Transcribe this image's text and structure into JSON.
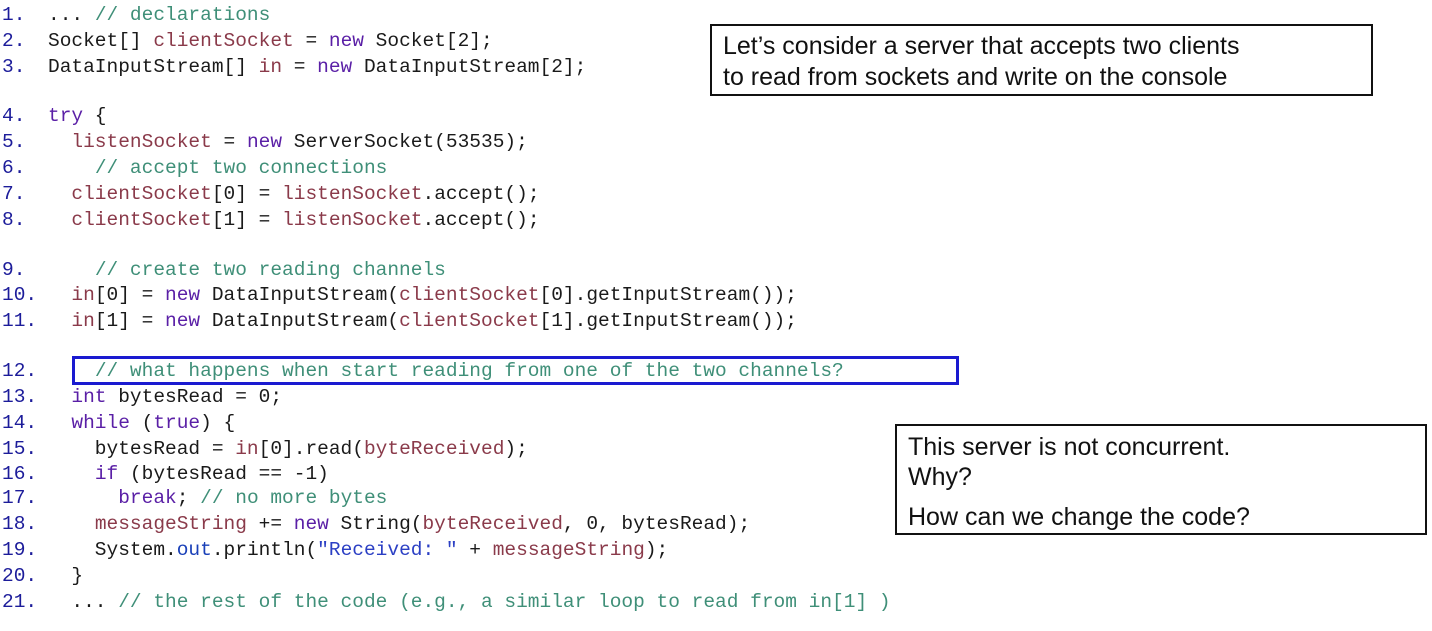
{
  "code": {
    "lines": [
      {
        "num": "1.",
        "tokens": [
          {
            "t": "... ",
            "c": "plain"
          },
          {
            "t": "// declarations",
            "c": "comment"
          }
        ]
      },
      {
        "num": "2.",
        "tokens": [
          {
            "t": "Socket[] ",
            "c": "plain"
          },
          {
            "t": "clientSocket",
            "c": "var"
          },
          {
            "t": " = ",
            "c": "plain"
          },
          {
            "t": "new",
            "c": "kw"
          },
          {
            "t": " Socket[2];",
            "c": "plain"
          }
        ]
      },
      {
        "num": "3.",
        "tokens": [
          {
            "t": "DataInputStream[] ",
            "c": "plain"
          },
          {
            "t": "in",
            "c": "var"
          },
          {
            "t": " = ",
            "c": "plain"
          },
          {
            "t": "new",
            "c": "kw"
          },
          {
            "t": " DataInputStream[2];",
            "c": "plain"
          }
        ]
      },
      {
        "num": "4.",
        "tokens": [
          {
            "t": "try",
            "c": "kw"
          },
          {
            "t": " {",
            "c": "plain"
          }
        ]
      },
      {
        "num": "5.",
        "tokens": [
          {
            "t": "  ",
            "c": "plain"
          },
          {
            "t": "listenSocket",
            "c": "var"
          },
          {
            "t": " = ",
            "c": "plain"
          },
          {
            "t": "new",
            "c": "kw"
          },
          {
            "t": " ServerSocket(53535);",
            "c": "plain"
          }
        ]
      },
      {
        "num": "6.",
        "tokens": [
          {
            "t": "    ",
            "c": "plain"
          },
          {
            "t": "// accept two connections",
            "c": "comment"
          }
        ]
      },
      {
        "num": "7.",
        "tokens": [
          {
            "t": "  ",
            "c": "plain"
          },
          {
            "t": "clientSocket",
            "c": "var"
          },
          {
            "t": "[0] = ",
            "c": "plain"
          },
          {
            "t": "listenSocket",
            "c": "var"
          },
          {
            "t": ".accept();",
            "c": "plain"
          }
        ]
      },
      {
        "num": "8.",
        "tokens": [
          {
            "t": "  ",
            "c": "plain"
          },
          {
            "t": "clientSocket",
            "c": "var"
          },
          {
            "t": "[1] = ",
            "c": "plain"
          },
          {
            "t": "listenSocket",
            "c": "var"
          },
          {
            "t": ".accept();",
            "c": "plain"
          }
        ]
      },
      {
        "num": "9.",
        "tokens": [
          {
            "t": "    ",
            "c": "plain"
          },
          {
            "t": "// create two reading channels",
            "c": "comment"
          }
        ]
      },
      {
        "num": "10.",
        "tokens": [
          {
            "t": "  ",
            "c": "plain"
          },
          {
            "t": "in",
            "c": "var"
          },
          {
            "t": "[0] = ",
            "c": "plain"
          },
          {
            "t": "new",
            "c": "kw"
          },
          {
            "t": " DataInputStream(",
            "c": "plain"
          },
          {
            "t": "clientSocket",
            "c": "var"
          },
          {
            "t": "[0].getInputStream());",
            "c": "plain"
          }
        ]
      },
      {
        "num": "11.",
        "tokens": [
          {
            "t": "  ",
            "c": "plain"
          },
          {
            "t": "in",
            "c": "var"
          },
          {
            "t": "[1] = ",
            "c": "plain"
          },
          {
            "t": "new",
            "c": "kw"
          },
          {
            "t": " DataInputStream(",
            "c": "plain"
          },
          {
            "t": "clientSocket",
            "c": "var"
          },
          {
            "t": "[1].getInputStream());",
            "c": "plain"
          }
        ]
      },
      {
        "num": "12.",
        "tokens": [
          {
            "t": "    ",
            "c": "plain"
          },
          {
            "t": "// what happens when start reading from one of the two channels?",
            "c": "comment"
          }
        ]
      },
      {
        "num": "13.",
        "tokens": [
          {
            "t": "  ",
            "c": "plain"
          },
          {
            "t": "int",
            "c": "kw"
          },
          {
            "t": " bytesRead = 0;",
            "c": "plain"
          }
        ]
      },
      {
        "num": "14.",
        "tokens": [
          {
            "t": "  ",
            "c": "plain"
          },
          {
            "t": "while",
            "c": "kw"
          },
          {
            "t": " (",
            "c": "plain"
          },
          {
            "t": "true",
            "c": "kw"
          },
          {
            "t": ") {",
            "c": "plain"
          }
        ]
      },
      {
        "num": "15.",
        "tokens": [
          {
            "t": "    bytesRead = ",
            "c": "plain"
          },
          {
            "t": "in",
            "c": "var"
          },
          {
            "t": "[0].read(",
            "c": "plain"
          },
          {
            "t": "byteReceived",
            "c": "var"
          },
          {
            "t": ");",
            "c": "plain"
          }
        ]
      },
      {
        "num": "16.",
        "tokens": [
          {
            "t": "    ",
            "c": "plain"
          },
          {
            "t": "if",
            "c": "kw"
          },
          {
            "t": " (bytesRead == -1)",
            "c": "plain"
          }
        ]
      },
      {
        "num": "17.",
        "tokens": [
          {
            "t": "      ",
            "c": "plain"
          },
          {
            "t": "break",
            "c": "kw"
          },
          {
            "t": "; ",
            "c": "plain"
          },
          {
            "t": "// no more bytes",
            "c": "comment"
          }
        ]
      },
      {
        "num": "18.",
        "tokens": [
          {
            "t": "    ",
            "c": "plain"
          },
          {
            "t": "messageString",
            "c": "var"
          },
          {
            "t": " += ",
            "c": "plain"
          },
          {
            "t": "new",
            "c": "kw"
          },
          {
            "t": " String(",
            "c": "plain"
          },
          {
            "t": "byteReceived",
            "c": "var"
          },
          {
            "t": ", 0, bytesRead);",
            "c": "plain"
          }
        ]
      },
      {
        "num": "19.",
        "tokens": [
          {
            "t": "    System.",
            "c": "plain"
          },
          {
            "t": "out",
            "c": "field"
          },
          {
            "t": ".println(",
            "c": "plain"
          },
          {
            "t": "\"Received: \"",
            "c": "str"
          },
          {
            "t": " + ",
            "c": "plain"
          },
          {
            "t": "messageString",
            "c": "var"
          },
          {
            "t": ");",
            "c": "plain"
          }
        ]
      },
      {
        "num": "20.",
        "tokens": [
          {
            "t": "  }",
            "c": "plain"
          }
        ]
      },
      {
        "num": "21.",
        "tokens": [
          {
            "t": "  ... ",
            "c": "plain"
          },
          {
            "t": "// the rest of the code (e.g., a similar loop to read from in[1] )",
            "c": "comment"
          }
        ]
      }
    ]
  },
  "note_top": {
    "lines": [
      "Let’s consider a server that accepts two clients",
      "to read from sockets and write on the console"
    ]
  },
  "note_bottom": {
    "lines": [
      "This server is not concurrent.",
      "Why?",
      "How can we change the code?"
    ]
  },
  "colors": {
    "line_number": "#1c1c9a",
    "comment": "#3f8f78",
    "keyword": "#5a1fa6",
    "variable": "#8a3a4a",
    "highlight_border": "#1a1ad0"
  }
}
